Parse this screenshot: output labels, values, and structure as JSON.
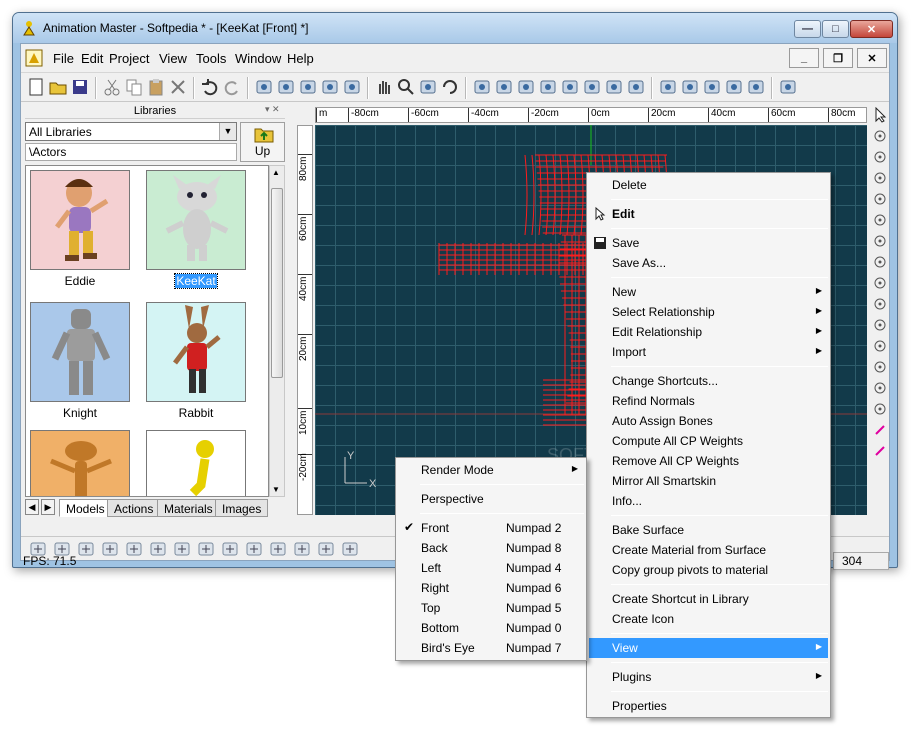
{
  "window": {
    "title": "Animation Master - Softpedia * - [KeeKat [Front] *]",
    "caption_buttons": {
      "minimize": "—",
      "maximize": "□",
      "close": "✕"
    }
  },
  "menubar": {
    "items": [
      "File",
      "Edit",
      "Project",
      "View",
      "Tools",
      "Window",
      "Help"
    ],
    "mdi_buttons": {
      "minimize": "_",
      "restore": "❐",
      "close": "✕"
    }
  },
  "toolbar": {
    "icons": [
      "new-icon",
      "open-icon",
      "save-all-icon",
      "cut-icon",
      "copy-icon",
      "paste-icon",
      "delete-icon",
      "undo-icon",
      "redo-icon",
      "render-icon",
      "render-lock-icon",
      "render-to-file-icon",
      "render-animation-icon",
      "stereo-icon",
      "hand-icon",
      "zoom-icon",
      "zoom-fit-icon",
      "rotate-icon",
      "bones-mode-icon",
      "muscle-mode-icon",
      "skeleton-mode-icon",
      "action-mode-icon",
      "pose-icon",
      "walk-icon",
      "dopesheet-icon",
      "choreography-icon",
      "bounding-box-icon",
      "move-icon",
      "scale-icon",
      "world-icon",
      "globe-icon",
      "plugin-icon"
    ]
  },
  "libraries": {
    "title": "Libraries",
    "select_value": "All Libraries",
    "path": "\\Actors",
    "up_label": "Up",
    "items": [
      {
        "name": "Eddie",
        "color": "#f4d0d2"
      },
      {
        "name": "KeeKat",
        "color": "#c9ecd2"
      },
      {
        "name": "Knight",
        "color": "#aac8ea"
      },
      {
        "name": "Rabbit",
        "color": "#d4f4f4"
      },
      {
        "name": "",
        "color": "#f0b068"
      },
      {
        "name": "",
        "color": "#ffffff"
      }
    ],
    "tabs": [
      "Models",
      "Actions",
      "Materials",
      "Images"
    ],
    "selected": "KeeKat"
  },
  "rulers": {
    "top": [
      "m",
      "-80cm",
      "-60cm",
      "-40cm",
      "-20cm",
      "0cm",
      "20cm",
      "40cm",
      "60cm",
      "80cm"
    ],
    "left": [
      "80cm",
      "60cm",
      "40cm",
      "20cm",
      "10cm",
      "-20cm"
    ]
  },
  "viewport": {
    "background": "#123a4a",
    "grid": "#2e5d6c",
    "mesh_color": "#ff1c1c",
    "axis_x_label": "X",
    "axis_y_label": "Y",
    "watermark": "SOFTPEDIA"
  },
  "status": {
    "fps": "FPS: 71.5",
    "right_value": "304"
  },
  "context_menu": [
    {
      "type": "item",
      "label": "Delete"
    },
    {
      "type": "sep"
    },
    {
      "type": "item",
      "label": "Edit",
      "bold": true,
      "icon": "edit-arrow-icon"
    },
    {
      "type": "sep"
    },
    {
      "type": "item",
      "label": "Save",
      "icon": "floppy-icon"
    },
    {
      "type": "item",
      "label": "Save As..."
    },
    {
      "type": "sep"
    },
    {
      "type": "item",
      "label": "New",
      "sub": true
    },
    {
      "type": "item",
      "label": "Select Relationship",
      "sub": true
    },
    {
      "type": "item",
      "label": "Edit Relationship",
      "sub": true
    },
    {
      "type": "item",
      "label": "Import",
      "sub": true
    },
    {
      "type": "sep"
    },
    {
      "type": "item",
      "label": "Change Shortcuts..."
    },
    {
      "type": "item",
      "label": "Refind Normals"
    },
    {
      "type": "item",
      "label": "Auto Assign Bones"
    },
    {
      "type": "item",
      "label": "Compute All CP Weights"
    },
    {
      "type": "item",
      "label": "Remove All CP Weights"
    },
    {
      "type": "item",
      "label": "Mirror All Smartskin"
    },
    {
      "type": "item",
      "label": "Info..."
    },
    {
      "type": "sep"
    },
    {
      "type": "item",
      "label": "Bake Surface"
    },
    {
      "type": "item",
      "label": "Create Material from Surface"
    },
    {
      "type": "item",
      "label": "Copy group pivots to material"
    },
    {
      "type": "sep"
    },
    {
      "type": "item",
      "label": "Create Shortcut in Library"
    },
    {
      "type": "item",
      "label": "Create Icon"
    },
    {
      "type": "sep"
    },
    {
      "type": "item",
      "label": "View",
      "sub": true,
      "highlighted": true
    },
    {
      "type": "sep"
    },
    {
      "type": "item",
      "label": "Plugins",
      "sub": true
    },
    {
      "type": "sep"
    },
    {
      "type": "item",
      "label": "Properties"
    }
  ],
  "view_submenu": [
    {
      "type": "item",
      "label": "Render Mode",
      "sub": true
    },
    {
      "type": "sep"
    },
    {
      "type": "item",
      "label": "Perspective"
    },
    {
      "type": "sep"
    },
    {
      "type": "item",
      "label": "Front",
      "key": "Numpad 2",
      "checked": true
    },
    {
      "type": "item",
      "label": "Back",
      "key": "Numpad 8"
    },
    {
      "type": "item",
      "label": "Left",
      "key": "Numpad 4"
    },
    {
      "type": "item",
      "label": "Right",
      "key": "Numpad 6"
    },
    {
      "type": "item",
      "label": "Top",
      "key": "Numpad 5"
    },
    {
      "type": "item",
      "label": "Bottom",
      "key": "Numpad 0"
    },
    {
      "type": "item",
      "label": "Bird's Eye",
      "key": "Numpad 7"
    }
  ]
}
